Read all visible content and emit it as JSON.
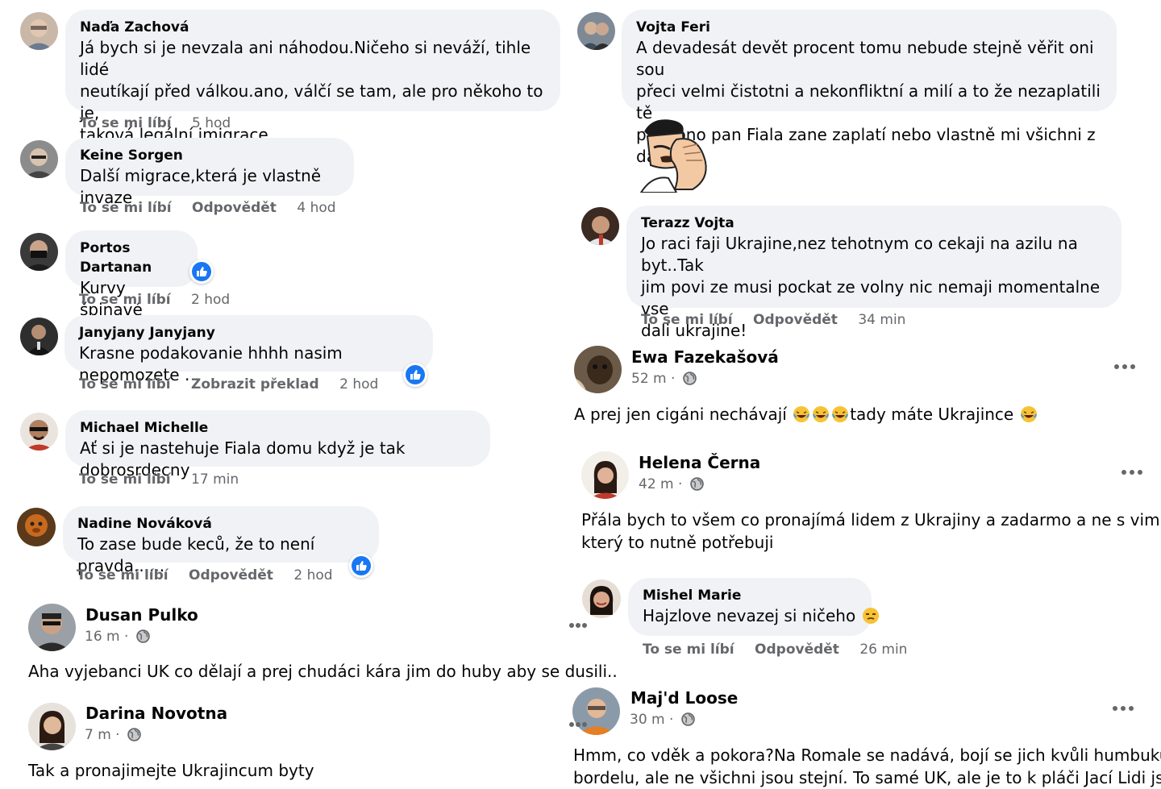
{
  "left": {
    "comments": [
      {
        "name": "Naďa Zachová",
        "lines": [
          "Já bych si je nevzala ani náhodou.Ničeho si neváží, tihle lidé",
          "neutíkají před válkou.ano, válčí se tam, ale pro někoho to je,",
          "taková legální imigrace"
        ],
        "like": "To se mi líbí",
        "reply": "",
        "translate": "",
        "time": "5 hod"
      },
      {
        "name": "Keine Sorgen",
        "lines": [
          "Další migrace,která je vlastně invaze"
        ],
        "like": "To se mi líbí",
        "reply": "Odpovědět",
        "translate": "",
        "time": "4 hod"
      },
      {
        "name": "Portos Dartanan",
        "lines": [
          "Kurvy špinavé"
        ],
        "like": "To se mi líbí",
        "reply": "",
        "translate": "",
        "time": "2 hod"
      },
      {
        "name": "Janyjany Janyjany",
        "lines": [
          "Krasne podakovanie hhhh nasim nepomozete ."
        ],
        "like": "To se mi líbí",
        "reply": "",
        "translate": "Zobrazit překlad",
        "time": "2 hod"
      },
      {
        "name": "Michael Michelle",
        "lines": [
          "Ať si je nastehuje Fiala domu když je tak dobrosrdecny"
        ],
        "like": "To se mi líbí",
        "reply": "",
        "translate": "",
        "time": "17 min"
      },
      {
        "name": "Nadine Nováková",
        "lines": [
          "To zase bude keců, že to není pravda......"
        ],
        "like": "To se mi líbí",
        "reply": "Odpovědět",
        "translate": "",
        "time": "2 hod"
      }
    ],
    "posts": [
      {
        "name": "Dusan Pulko",
        "meta": "16 m ·",
        "text": "Aha vyjebanci UK co dělají a prej chudáci kára jim do huby aby se dusili.."
      },
      {
        "name": "Darina Novotna",
        "meta": "7 m ·",
        "text": "Tak a pronajimejte Ukrajincum byty"
      }
    ]
  },
  "right": {
    "comment_vojta": {
      "name": "Vojta Feri",
      "lines": [
        "A devadesát devět procent tomu nebude stejně věřit oni sou",
        "přeci velmi čistotni a nekonfliktní a milí a to že nezaplatili tě",
        "paní ono pan Fiala zane zaplatí nebo vlastně mi všichni z daní"
      ]
    },
    "comment_terazz": {
      "name": "Terazz Vojta",
      "lines": [
        "Jo raci faji Ukrajine,nez tehotnym co cekaji na azilu na byt..Tak",
        "jim povi ze musi pockat ze volny nic nemaji momentalne vse",
        "dali ukrajine!"
      ],
      "like": "To se mi líbí",
      "reply": "Odpovědět",
      "time": "34 min"
    },
    "post_ewa": {
      "name": "Ewa Fazekašová",
      "meta": "52 m ·",
      "text_before": "A prej jen cigáni nechávají ",
      "text_after": "tady máte Ukrajince "
    },
    "post_helena": {
      "name": "Helena Černa",
      "meta": "42 m ·",
      "lines": [
        "Přála bych to všem co pronajímá lidem z Ukrajiny a zadarmo a ne s vim lidem",
        "který to nutně potřebuji"
      ]
    },
    "comment_mishel": {
      "name": "Mishel Marie",
      "text": "Hajzlove nevazej si ničeho ",
      "like": "To se mi líbí",
      "reply": "Odpovědět",
      "time": "26 min"
    },
    "post_maj": {
      "name": "Maj'd Loose",
      "meta": "30 m ·",
      "lines": [
        "Hmm, co vděk a pokora?Na Romale se nadává, bojí se jich kvůli humbuku a",
        "bordelu, ale ne všichni jsou stejní. To samé UK, ale je to k pláči Jací Lidi jsou..."
      ]
    }
  },
  "colors": {
    "bubble": "#f0f2f5",
    "meta": "#65676b",
    "text": "#050505",
    "like_blue": "#1877f2"
  },
  "icons": [
    "like-icon",
    "globe-icon",
    "more-dots-icon",
    "laughing-emoji-icon",
    "unamused-emoji-icon",
    "facepalm-sticker"
  ]
}
